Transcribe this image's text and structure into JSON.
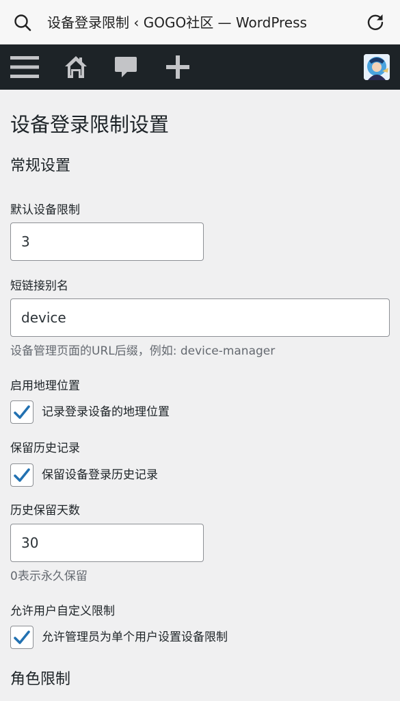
{
  "browser": {
    "title": "设备登录限制 ‹ GOGO社区 — WordPress"
  },
  "adminbar": {
    "icons": [
      "menu-icon",
      "home-icon",
      "comment-icon",
      "plus-icon",
      "avatar"
    ]
  },
  "page": {
    "title": "设备登录限制设置",
    "general_section": "常规设置",
    "role_section": "角色限制"
  },
  "fields": {
    "default_limit": {
      "label": "默认设备限制",
      "value": "3"
    },
    "slug": {
      "label": "短链接别名",
      "value": "device",
      "description": "设备管理页面的URL后缀，例如: device-manager"
    },
    "geo": {
      "label": "启用地理位置",
      "checkbox_label": "记录登录设备的地理位置",
      "checked": true
    },
    "history": {
      "label": "保留历史记录",
      "checkbox_label": "保留设备登录历史记录",
      "checked": true
    },
    "history_days": {
      "label": "历史保留天数",
      "value": "30",
      "description": "0表示永久保留"
    },
    "user_custom": {
      "label": "允许用户自定义限制",
      "checkbox_label": "允许管理员为单个用户设置设备限制",
      "checked": true
    }
  },
  "colors": {
    "adminbar_bg": "#1d2327",
    "page_bg": "#f0f0f1",
    "check_color": "#2271b1"
  }
}
